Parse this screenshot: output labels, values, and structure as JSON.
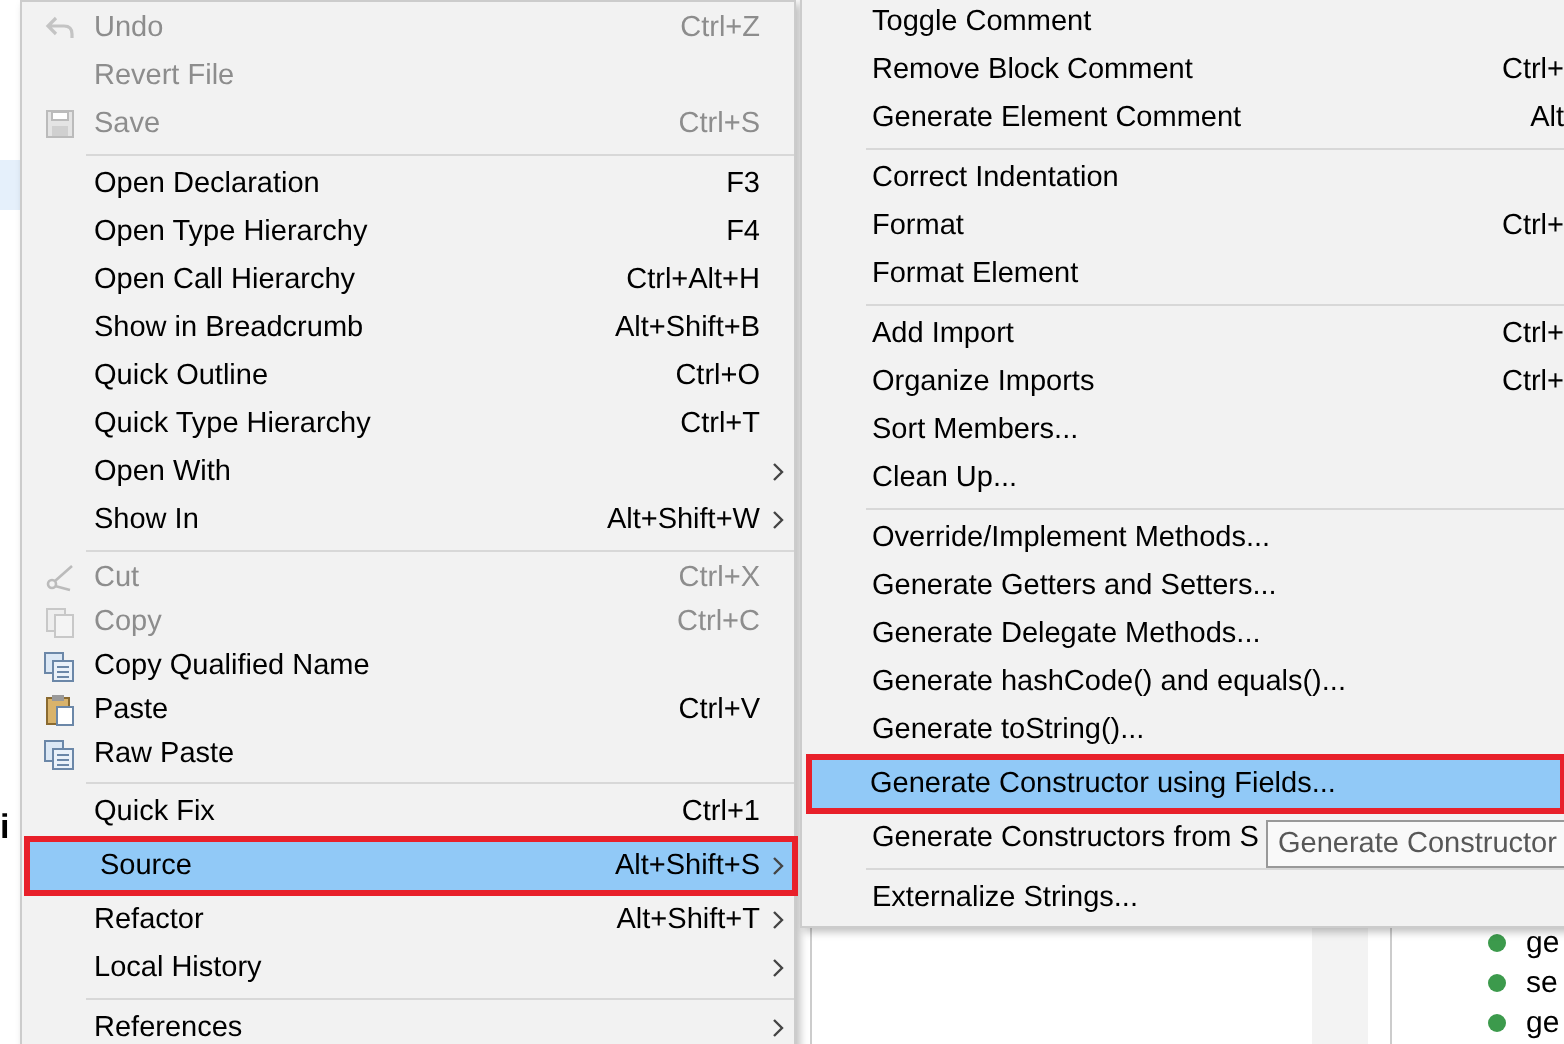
{
  "editor": {
    "fragment": "i"
  },
  "context_menu": {
    "groups": [
      [
        {
          "label": "Undo",
          "shortcut": "Ctrl+Z",
          "disabled": true,
          "selected": false,
          "submenu": false,
          "outlined": false
        },
        {
          "label": "Revert File",
          "disabled": true,
          "selected": false,
          "submenu": false,
          "outlined": false
        },
        {
          "label": "Save",
          "shortcut": "Ctrl+S",
          "disabled": true,
          "selected": false,
          "submenu": false,
          "outlined": false
        }
      ],
      [
        {
          "label": "Open Declaration",
          "shortcut": "F3",
          "disabled": false,
          "selected": false,
          "submenu": false,
          "outlined": false
        },
        {
          "label": "Open Type Hierarchy",
          "shortcut": "F4",
          "disabled": false,
          "selected": false,
          "submenu": false,
          "outlined": false
        },
        {
          "label": "Open Call Hierarchy",
          "shortcut": "Ctrl+Alt+H",
          "disabled": false,
          "selected": false,
          "submenu": false,
          "outlined": false
        },
        {
          "label": "Show in Breadcrumb",
          "shortcut": "Alt+Shift+B",
          "disabled": false,
          "selected": false,
          "submenu": false,
          "outlined": false
        },
        {
          "label": "Quick Outline",
          "shortcut": "Ctrl+O",
          "disabled": false,
          "selected": false,
          "submenu": false,
          "outlined": false
        },
        {
          "label": "Quick Type Hierarchy",
          "shortcut": "Ctrl+T",
          "disabled": false,
          "selected": false,
          "submenu": false,
          "outlined": false
        },
        {
          "label": "Open With",
          "disabled": false,
          "selected": false,
          "submenu": true,
          "outlined": false
        },
        {
          "label": "Show In",
          "shortcut": "Alt+Shift+W",
          "disabled": false,
          "selected": false,
          "submenu": true,
          "outlined": false
        }
      ],
      [
        {
          "label": "Cut",
          "shortcut": "Ctrl+X",
          "disabled": true,
          "selected": false,
          "submenu": false,
          "outlined": false
        },
        {
          "label": "Copy",
          "shortcut": "Ctrl+C",
          "disabled": true,
          "selected": false,
          "submenu": false,
          "outlined": false
        },
        {
          "label": "Copy Qualified Name",
          "disabled": false,
          "selected": false,
          "submenu": false,
          "outlined": false
        },
        {
          "label": "Paste",
          "shortcut": "Ctrl+V",
          "disabled": false,
          "selected": false,
          "submenu": false,
          "outlined": false
        },
        {
          "label": "Raw Paste",
          "disabled": false,
          "selected": false,
          "submenu": false,
          "outlined": false
        }
      ],
      [
        {
          "label": "Quick Fix",
          "shortcut": "Ctrl+1",
          "disabled": false,
          "selected": false,
          "submenu": false,
          "outlined": false
        },
        {
          "label": "Source",
          "shortcut": "Alt+Shift+S",
          "disabled": false,
          "selected": true,
          "submenu": true,
          "outlined": true
        },
        {
          "label": "Refactor",
          "shortcut": "Alt+Shift+T",
          "disabled": false,
          "selected": false,
          "submenu": true,
          "outlined": false
        },
        {
          "label": "Local History",
          "disabled": false,
          "selected": false,
          "submenu": true,
          "outlined": false
        }
      ],
      [
        {
          "label": "References",
          "disabled": false,
          "selected": false,
          "submenu": true,
          "outlined": false
        }
      ]
    ]
  },
  "source_submenu": {
    "groups": [
      [
        {
          "label": "Toggle Comment",
          "selected": false,
          "outlined": false
        },
        {
          "label": "Remove Block Comment",
          "shortcut": "Ctrl+",
          "selected": false,
          "outlined": false
        },
        {
          "label": "Generate Element Comment",
          "shortcut": "Alt",
          "selected": false,
          "outlined": false
        }
      ],
      [
        {
          "label": "Correct Indentation",
          "selected": false,
          "outlined": false
        },
        {
          "label": "Format",
          "shortcut": "Ctrl+",
          "selected": false,
          "outlined": false
        },
        {
          "label": "Format Element",
          "selected": false,
          "outlined": false
        }
      ],
      [
        {
          "label": "Add Import",
          "shortcut": "Ctrl+",
          "selected": false,
          "outlined": false
        },
        {
          "label": "Organize Imports",
          "shortcut": "Ctrl+",
          "selected": false,
          "outlined": false
        },
        {
          "label": "Sort Members...",
          "selected": false,
          "outlined": false
        },
        {
          "label": "Clean Up...",
          "selected": false,
          "outlined": false
        }
      ],
      [
        {
          "label": "Override/Implement Methods...",
          "selected": false,
          "outlined": false
        },
        {
          "label": "Generate Getters and Setters...",
          "selected": false,
          "outlined": false
        },
        {
          "label": "Generate Delegate Methods...",
          "selected": false,
          "outlined": false
        },
        {
          "label": "Generate hashCode() and equals()...",
          "selected": false,
          "outlined": false
        },
        {
          "label": "Generate toString()...",
          "selected": false,
          "outlined": false
        },
        {
          "label": "Generate Constructor using Fields...",
          "selected": true,
          "outlined": true
        },
        {
          "label": "Generate Constructors from S",
          "selected": false,
          "outlined": false
        }
      ],
      [
        {
          "label": "Externalize Strings...",
          "selected": false,
          "outlined": false
        }
      ]
    ]
  },
  "tooltip": {
    "text": "Generate Constructor"
  },
  "outline_panel": {
    "items": [
      {
        "label": "ge"
      },
      {
        "label": "se"
      },
      {
        "label": "ge"
      }
    ]
  }
}
